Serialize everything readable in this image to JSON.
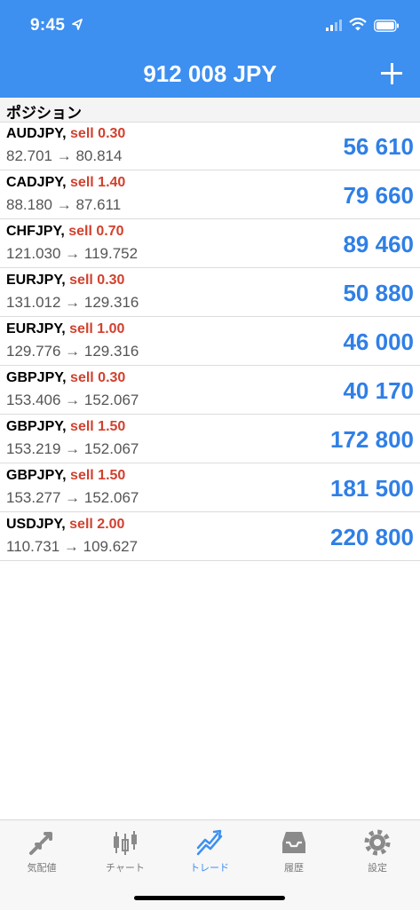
{
  "status_bar": {
    "time": "9:45",
    "icons": [
      "location-arrow-icon",
      "cellular-signal-icon",
      "wifi-icon",
      "battery-icon"
    ]
  },
  "header": {
    "title": "912 008 JPY",
    "add_icon": "plus-icon"
  },
  "section": {
    "title": "ポジション"
  },
  "positions": [
    {
      "symbol": "AUDJPY,",
      "side": "sell 0.30",
      "prices": "82.701 → 80.814",
      "profit": "56 610"
    },
    {
      "symbol": "CADJPY,",
      "side": "sell 1.40",
      "prices": "88.180 → 87.611",
      "profit": "79 660"
    },
    {
      "symbol": "CHFJPY,",
      "side": "sell 0.70",
      "prices": "121.030 → 119.752",
      "profit": "89 460"
    },
    {
      "symbol": "EURJPY,",
      "side": "sell 0.30",
      "prices": "131.012 → 129.316",
      "profit": "50 880"
    },
    {
      "symbol": "EURJPY,",
      "side": "sell 1.00",
      "prices": "129.776 → 129.316",
      "profit": "46 000"
    },
    {
      "symbol": "GBPJPY,",
      "side": "sell 0.30",
      "prices": "153.406 → 152.067",
      "profit": "40 170"
    },
    {
      "symbol": "GBPJPY,",
      "side": "sell 1.50",
      "prices": "153.219 → 152.067",
      "profit": "172 800"
    },
    {
      "symbol": "GBPJPY,",
      "side": "sell 1.50",
      "prices": "153.277 → 152.067",
      "profit": "181 500"
    },
    {
      "symbol": "USDJPY,",
      "side": "sell 2.00",
      "prices": "110.731 → 109.627",
      "profit": "220 800"
    }
  ],
  "tabs": [
    {
      "label": "気配値",
      "icon": "quotes-arrows-icon",
      "active": false
    },
    {
      "label": "チャート",
      "icon": "candlestick-chart-icon",
      "active": false
    },
    {
      "label": "トレード",
      "icon": "trade-chart-icon",
      "active": true
    },
    {
      "label": "履歴",
      "icon": "history-tray-icon",
      "active": false
    },
    {
      "label": "設定",
      "icon": "gear-icon",
      "active": false
    }
  ],
  "colors": {
    "header_bg": "#3d8ff0",
    "sell": "#d1412e",
    "profit": "#2f7fe6",
    "tab_active": "#3d8ff0",
    "tab_inactive": "#7a7a7a"
  }
}
